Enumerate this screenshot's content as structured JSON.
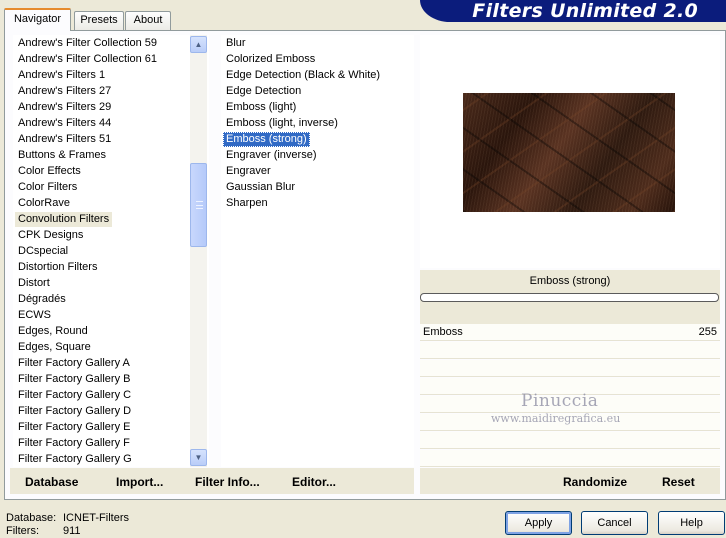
{
  "tabs": [
    {
      "label": "Navigator"
    },
    {
      "label": "Presets"
    },
    {
      "label": "About"
    }
  ],
  "banner_title": "Filters Unlimited 2.0",
  "categories": [
    "Andrew's Filter Collection 59",
    "Andrew's Filter Collection 61",
    "Andrew's Filters 1",
    "Andrew's Filters 27",
    "Andrew's Filters 29",
    "Andrew's Filters 44",
    "Andrew's Filters 51",
    "Buttons & Frames",
    "Color Effects",
    "Color Filters",
    "ColorRave",
    "Convolution Filters",
    "CPK Designs",
    "DCspecial",
    "Distortion Filters",
    "Distort",
    "Dégradés",
    "ECWS",
    "Edges, Round",
    "Edges, Square",
    "Filter Factory Gallery A",
    "Filter Factory Gallery B",
    "Filter Factory Gallery C",
    "Filter Factory Gallery D",
    "Filter Factory Gallery E",
    "Filter Factory Gallery F",
    "Filter Factory Gallery G"
  ],
  "selected_category": "Convolution Filters",
  "filters": [
    "Blur",
    "Colorized Emboss",
    "Edge Detection (Black & White)",
    "Edge Detection",
    "Emboss (light)",
    "Emboss (light, inverse)",
    "Emboss (strong)",
    "Engraver (inverse)",
    "Engraver",
    "Gaussian Blur",
    "Sharpen"
  ],
  "selected_filter": "Emboss (strong)",
  "current_filter_name": "Emboss (strong)",
  "params": [
    {
      "label": "Emboss",
      "value": "255"
    }
  ],
  "watermark": {
    "line1": "Pinuccia",
    "line2": "www.maidiregrafica.eu"
  },
  "toolbar": {
    "database": "Database",
    "import": "Import...",
    "filter_info": "Filter Info...",
    "editor": "Editor...",
    "randomize": "Randomize",
    "reset": "Reset"
  },
  "status": {
    "database_label": "Database:",
    "database_value": "ICNET-Filters",
    "filters_label": "Filters:",
    "filters_value": "911"
  },
  "buttons": {
    "apply": "Apply",
    "cancel": "Cancel",
    "help": "Help"
  },
  "colors": {
    "banner": "#0b1c7c",
    "selection": "#316ac5",
    "dialog_bg": "#ece9d8"
  },
  "scrollbar_position": 0.28
}
